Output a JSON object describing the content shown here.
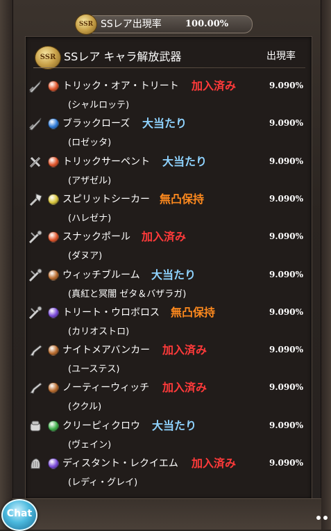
{
  "rate_summary": {
    "label": "SSレア出現率",
    "value": "100.00%"
  },
  "badge_text": "SSR",
  "header": {
    "title": "SSレア キャラ解放武器",
    "rate_label": "出現率"
  },
  "tag_colors": {
    "加入済み": "#ff3a3a",
    "大当たり": "#8fd3ff",
    "無凸保持": "#ff8a1e"
  },
  "element_colors": {
    "fire": "#e0542a",
    "water": "#2f7bd8",
    "earth": "#b86a2c",
    "wind": "#3fb04a",
    "light": "#d8c43a",
    "dark": "#7a4ad8"
  },
  "weapons": [
    {
      "name": "トリック・オア・トリート",
      "tag": "加入済み",
      "chara": "(シャルロッテ)",
      "rate": "9.090%",
      "element": "fire",
      "icon": "dagger-icon"
    },
    {
      "name": "ブラックローズ",
      "tag": "大当たり",
      "chara": "(ロゼッタ)",
      "rate": "9.090%",
      "element": "water",
      "icon": "dagger-icon"
    },
    {
      "name": "トリックサーペント",
      "tag": "大当たり",
      "chara": "(アザゼル)",
      "rate": "9.090%",
      "element": "fire",
      "icon": "sword-icon"
    },
    {
      "name": "スピリットシーカー",
      "tag": "無凸保持",
      "chara": "(ハレゼナ)",
      "rate": "9.090%",
      "element": "light",
      "icon": "axe-icon"
    },
    {
      "name": "スナックポール",
      "tag": "加入済み",
      "chara": "(ダヌア)",
      "rate": "9.090%",
      "element": "fire",
      "icon": "staff-icon"
    },
    {
      "name": "ウィッチブルーム",
      "tag": "大当たり",
      "chara": "(真紅と冥闇 ゼタ＆バザラガ)",
      "rate": "9.090%",
      "element": "earth",
      "icon": "staff-icon"
    },
    {
      "name": "トリート・ウロボロス",
      "tag": "無凸保持",
      "chara": "(カリオストロ)",
      "rate": "9.090%",
      "element": "dark",
      "icon": "staff-icon"
    },
    {
      "name": "ナイトメアバンカー",
      "tag": "加入済み",
      "chara": "(ユーステス)",
      "rate": "9.090%",
      "element": "earth",
      "icon": "gun-icon"
    },
    {
      "name": "ノーティーウィッチ",
      "tag": "加入済み",
      "chara": "(ククル)",
      "rate": "9.090%",
      "element": "earth",
      "icon": "gun-icon"
    },
    {
      "name": "クリーピィクロウ",
      "tag": "大当たり",
      "chara": "(ヴェイン)",
      "rate": "9.090%",
      "element": "wind",
      "icon": "fist-icon"
    },
    {
      "name": "ディスタント・レクイエム",
      "tag": "加入済み",
      "chara": "(レディ・グレイ)",
      "rate": "9.090%",
      "element": "dark",
      "icon": "harp-icon"
    }
  ],
  "chat_label": "Chat"
}
